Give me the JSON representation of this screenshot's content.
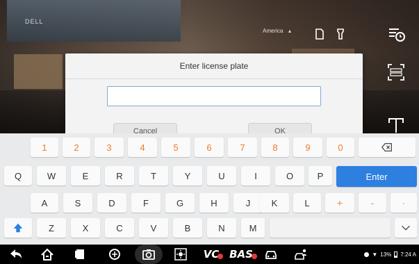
{
  "camera": {
    "monitor_label": "DELL",
    "region_label": "America"
  },
  "dialog": {
    "title": "Enter license plate",
    "input_value": "",
    "cancel_label": "Cancel",
    "ok_label": "OK"
  },
  "keyboard": {
    "row1": [
      "1",
      "2",
      "3",
      "4",
      "5",
      "6",
      "7",
      "8",
      "9",
      "0"
    ],
    "row2": [
      "Q",
      "W",
      "E",
      "R",
      "T",
      "Y",
      "U",
      "I",
      "O",
      "P"
    ],
    "row3": [
      "A",
      "S",
      "D",
      "F",
      "G",
      "H",
      "J",
      "K",
      "L",
      "+",
      "-",
      "·"
    ],
    "row4": [
      "Z",
      "X",
      "C",
      "V",
      "B",
      "N",
      "M"
    ],
    "enter_label": "Enter",
    "backspace_icon": "backspace-icon",
    "shift_icon": "shift-up-arrow-icon",
    "hide_icon": "chevron-down-icon"
  },
  "navbar": {
    "vc_label": "VC",
    "bas_label": "BAS",
    "status_battery": "13%",
    "status_time": "7:24 A"
  },
  "colors": {
    "accent_blue": "#2d7fe0",
    "number_orange": "#ee7a2a",
    "keyboard_bg": "#e9eaec",
    "navbar_bg": "#000000"
  }
}
